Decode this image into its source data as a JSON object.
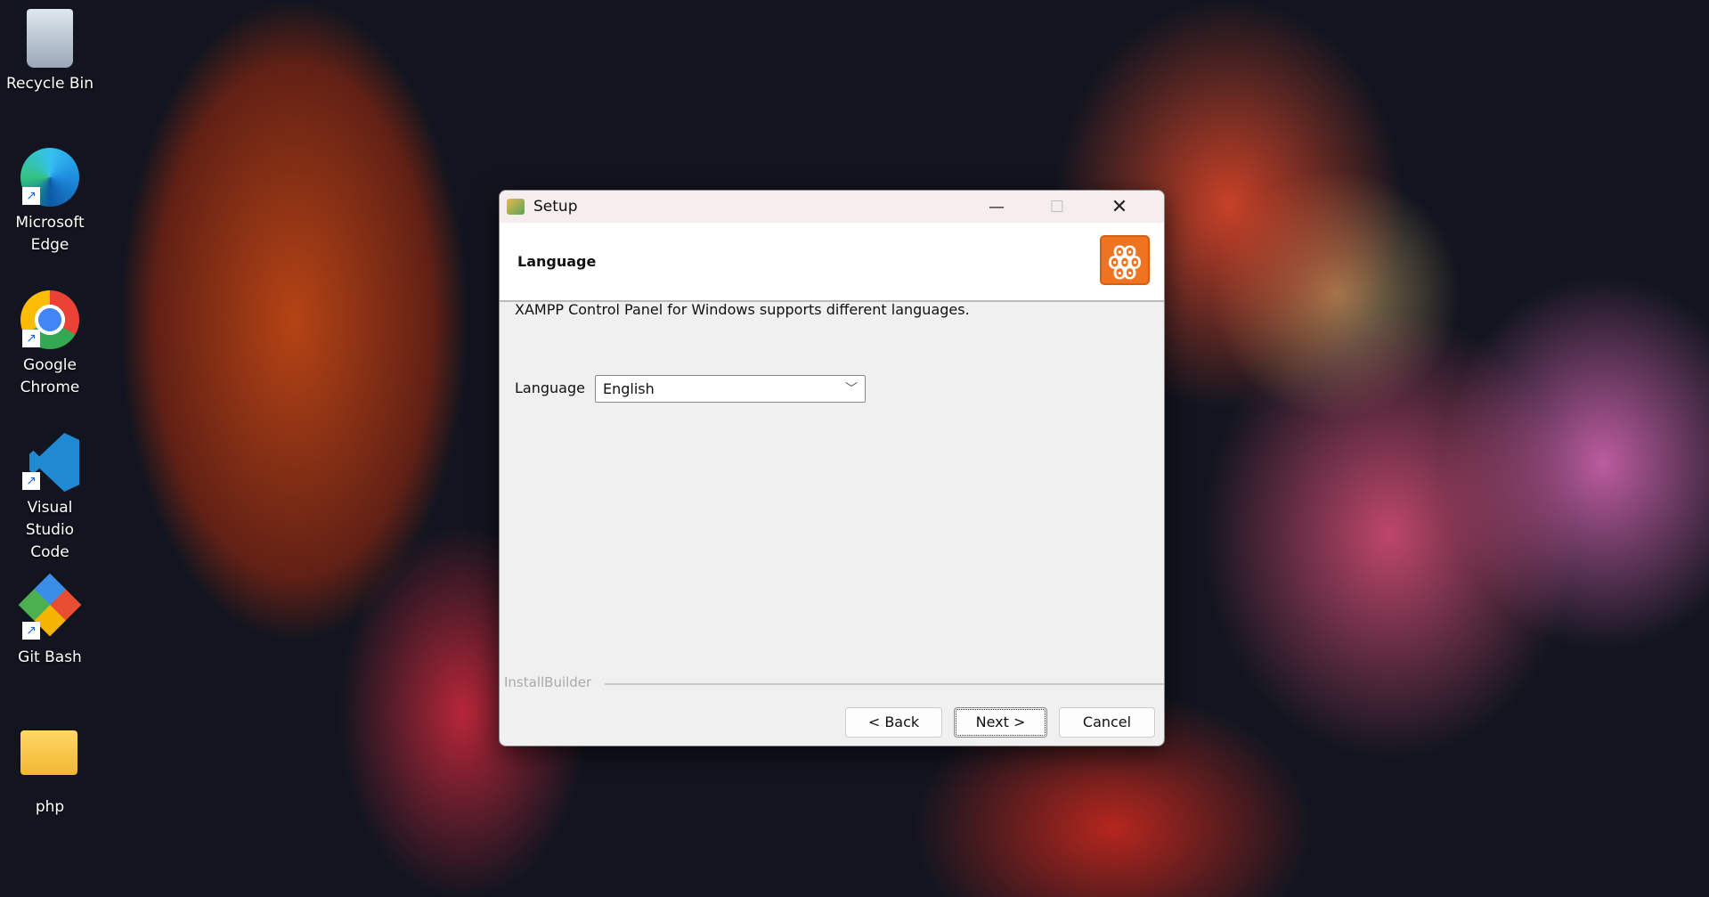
{
  "desktop": {
    "icons": [
      {
        "label": "Recycle Bin",
        "icon": "recycle-bin-icon"
      },
      {
        "label": "Microsoft Edge",
        "icon": "edge-icon"
      },
      {
        "label": "Google Chrome",
        "icon": "chrome-icon"
      },
      {
        "label": "Visual Studio Code",
        "icon": "vscode-icon"
      },
      {
        "label": "Git Bash",
        "icon": "git-bash-icon"
      },
      {
        "label": "php",
        "icon": "folder-icon"
      }
    ]
  },
  "dialog": {
    "title": "Setup",
    "header": "Language",
    "logo_text": "ဣ",
    "description": "XAMPP Control Panel for Windows supports different languages.",
    "language_label": "Language",
    "language_value": "English",
    "brand": "InstallBuilder",
    "buttons": {
      "back": "< Back",
      "next": "Next >",
      "cancel": "Cancel"
    },
    "accent": "#f07320"
  }
}
